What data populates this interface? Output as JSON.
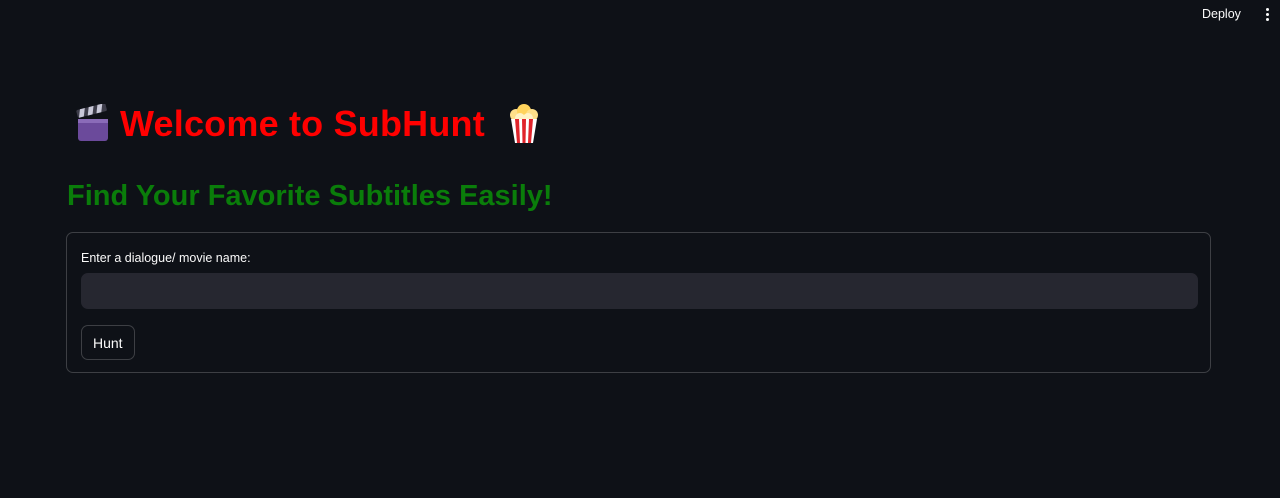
{
  "header": {
    "deploy_label": "Deploy",
    "menu_icon": "kebab-menu-icon"
  },
  "main": {
    "title": "Welcome to SubHunt",
    "title_icon_left": "clapperboard-icon",
    "title_icon_right": "popcorn-icon",
    "title_color": "#ff0000",
    "subtitle": "Find Your Favorite Subtitles Easily!",
    "subtitle_color": "#0a7d0a"
  },
  "form": {
    "label": "Enter a dialogue/ movie name:",
    "input_value": "",
    "input_placeholder": "",
    "button_label": "Hunt"
  },
  "colors": {
    "background": "#0e1117",
    "input_background": "#262730",
    "text": "#fafafa"
  }
}
